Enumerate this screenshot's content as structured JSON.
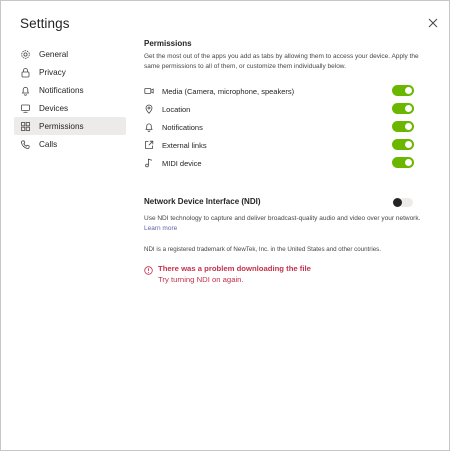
{
  "window": {
    "title": "Settings"
  },
  "sidebar": {
    "items": [
      {
        "label": "General",
        "icon": "gear-icon"
      },
      {
        "label": "Privacy",
        "icon": "lock-icon"
      },
      {
        "label": "Notifications",
        "icon": "bell-icon"
      },
      {
        "label": "Devices",
        "icon": "devices-icon"
      },
      {
        "label": "Permissions",
        "icon": "apps-grid-icon",
        "active": true
      },
      {
        "label": "Calls",
        "icon": "phone-icon"
      }
    ]
  },
  "permissions": {
    "heading": "Permissions",
    "description": "Get the most out of the apps you add as tabs by allowing them to access your device. Apply the same permissions to all of them, or customize them individually below.",
    "items": [
      {
        "label": "Media (Camera, microphone, speakers)",
        "icon": "camera-icon",
        "enabled": true
      },
      {
        "label": "Location",
        "icon": "location-pin-icon",
        "enabled": true
      },
      {
        "label": "Notifications",
        "icon": "bell-icon",
        "enabled": true
      },
      {
        "label": "External links",
        "icon": "external-link-icon",
        "enabled": true
      },
      {
        "label": "MIDI device",
        "icon": "music-note-icon",
        "enabled": true
      }
    ]
  },
  "ndi": {
    "heading": "Network Device Interface (NDI)",
    "enabled": false,
    "description": "Use NDI technology to capture and deliver broadcast-quality audio and video over your network.",
    "learn_more": "Learn more",
    "trademark": "NDI is a registered trademark of NewTek, Inc. in the United States and other countries.",
    "error_title": "There was a problem downloading the file",
    "error_subtitle": "Try turning NDI on again."
  },
  "colors": {
    "toggle_on": "#6bb700",
    "error": "#c4314b",
    "link": "#6264a7",
    "active_nav_bg": "#edebe9"
  }
}
